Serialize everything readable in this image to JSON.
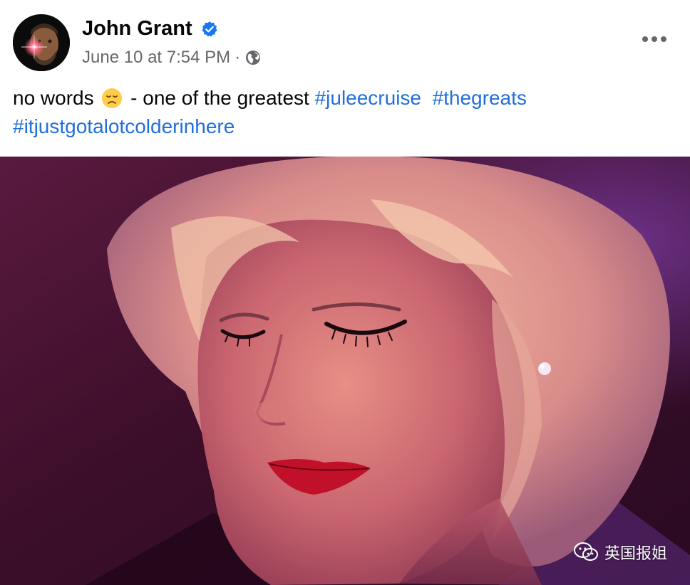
{
  "post": {
    "author": "John Grant",
    "author_verified": true,
    "timestamp": "June 10 at 7:54 PM",
    "separator": "·",
    "audience_icon": "globe-icon",
    "more_icon": "more-options-icon",
    "text_before_emoji": "no words",
    "emoji": "disappointed-face-emoji",
    "text_after_emoji": " - one of the greatest ",
    "hashtags": [
      "#juleecruise",
      "#thegreats",
      "#itjustgotalotcolderinhere"
    ]
  },
  "media": {
    "kind": "video-still",
    "watermark": "英国报姐",
    "watermark_icon": "wechat-icon"
  },
  "colors": {
    "hashtag": "#216fdb",
    "verified_badge": "#1877f2",
    "meta_text": "#65676b"
  }
}
